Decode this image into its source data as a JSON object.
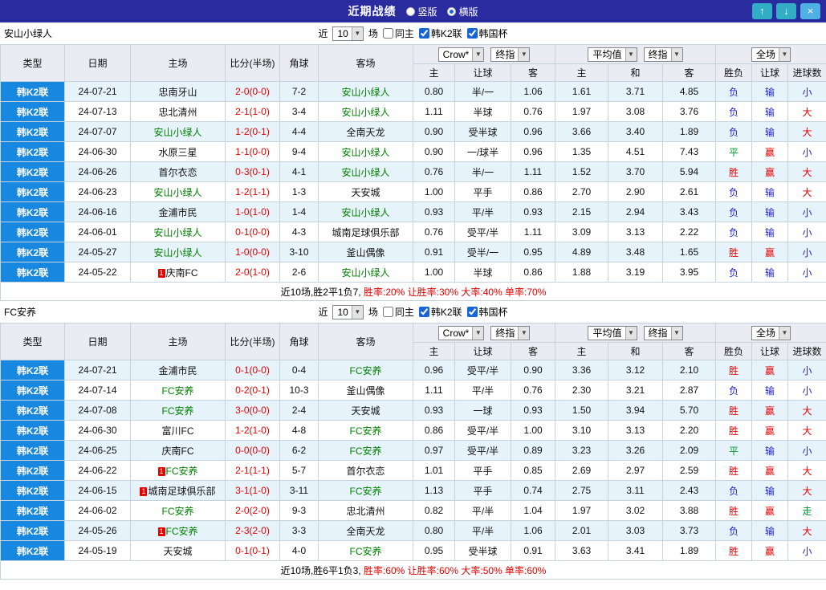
{
  "titlebar": {
    "title": "近期战绩",
    "radio_vertical": "竖版",
    "radio_horizontal": "横版",
    "up_icon": "↑",
    "down_icon": "↓",
    "close_icon": "×"
  },
  "filters": {
    "near": "近",
    "count": "10",
    "games": "场",
    "same_home": "同主",
    "k2": "韩K2联",
    "cup": "韩国杯"
  },
  "headers": {
    "type": "类型",
    "date": "日期",
    "home": "主场",
    "score": "比分(半场)",
    "corner": "角球",
    "away": "客场",
    "crow": "Crow*",
    "final": "终指",
    "avg": "平均值",
    "full": "全场",
    "h": "主",
    "hcap": "让球",
    "a": "客",
    "draw": "和",
    "wdl": "胜负",
    "hcap_res": "让球",
    "goals": "进球数"
  },
  "colors": {
    "win": "#e60000",
    "lose": "#2222cc",
    "draw": "#009933",
    "focal_team": "#008000",
    "score": "#e60000",
    "type_bg": "#1787e0",
    "titlebar_bg": "#2b2ba0"
  },
  "sections": [
    {
      "team": "安山小绿人",
      "rows": [
        {
          "league": "韩K2联",
          "date": "24-07-21",
          "home": "忠南牙山",
          "score": "2-0(0-0)",
          "corner": "7-2",
          "away": "安山小绿人",
          "crow_h": "0.80",
          "hcap": "半/一",
          "crow_a": "1.06",
          "avg_h": "1.61",
          "avg_d": "3.71",
          "avg_a": "4.85",
          "wdl": "负",
          "hcap_res": "输",
          "goals": "小"
        },
        {
          "league": "韩K2联",
          "date": "24-07-13",
          "home": "忠北清州",
          "score": "2-1(1-0)",
          "corner": "3-4",
          "away": "安山小绿人",
          "crow_h": "1.11",
          "hcap": "半球",
          "crow_a": "0.76",
          "avg_h": "1.97",
          "avg_d": "3.08",
          "avg_a": "3.76",
          "wdl": "负",
          "hcap_res": "输",
          "goals": "大"
        },
        {
          "league": "韩K2联",
          "date": "24-07-07",
          "home": "安山小绿人",
          "score": "1-2(0-1)",
          "corner": "4-4",
          "away": "全南天龙",
          "crow_h": "0.90",
          "hcap": "受半球",
          "crow_a": "0.96",
          "avg_h": "3.66",
          "avg_d": "3.40",
          "avg_a": "1.89",
          "wdl": "负",
          "hcap_res": "输",
          "goals": "大"
        },
        {
          "league": "韩K2联",
          "date": "24-06-30",
          "home": "水原三星",
          "score": "1-1(0-0)",
          "corner": "9-4",
          "away": "安山小绿人",
          "crow_h": "0.90",
          "hcap": "一/球半",
          "crow_a": "0.96",
          "avg_h": "1.35",
          "avg_d": "4.51",
          "avg_a": "7.43",
          "wdl": "平",
          "hcap_res": "赢",
          "goals": "小"
        },
        {
          "league": "韩K2联",
          "date": "24-06-26",
          "home": "首尔衣恋",
          "score": "0-3(0-1)",
          "corner": "4-1",
          "away": "安山小绿人",
          "crow_h": "0.76",
          "hcap": "半/一",
          "crow_a": "1.11",
          "avg_h": "1.52",
          "avg_d": "3.70",
          "avg_a": "5.94",
          "wdl": "胜",
          "hcap_res": "赢",
          "goals": "大"
        },
        {
          "league": "韩K2联",
          "date": "24-06-23",
          "home": "安山小绿人",
          "score": "1-2(1-1)",
          "corner": "1-3",
          "away": "天安城",
          "crow_h": "1.00",
          "hcap": "平手",
          "crow_a": "0.86",
          "avg_h": "2.70",
          "avg_d": "2.90",
          "avg_a": "2.61",
          "wdl": "负",
          "hcap_res": "输",
          "goals": "大"
        },
        {
          "league": "韩K2联",
          "date": "24-06-16",
          "home": "金浦市民",
          "score": "1-0(1-0)",
          "corner": "1-4",
          "away": "安山小绿人",
          "crow_h": "0.93",
          "hcap": "平/半",
          "crow_a": "0.93",
          "avg_h": "2.15",
          "avg_d": "2.94",
          "avg_a": "3.43",
          "wdl": "负",
          "hcap_res": "输",
          "goals": "小"
        },
        {
          "league": "韩K2联",
          "date": "24-06-01",
          "home": "安山小绿人",
          "score": "0-1(0-0)",
          "corner": "4-3",
          "away": "城南足球俱乐部",
          "crow_h": "0.76",
          "hcap": "受平/半",
          "crow_a": "1.11",
          "avg_h": "3.09",
          "avg_d": "3.13",
          "avg_a": "2.22",
          "wdl": "负",
          "hcap_res": "输",
          "goals": "小"
        },
        {
          "league": "韩K2联",
          "date": "24-05-27",
          "home": "安山小绿人",
          "score": "1-0(0-0)",
          "corner": "3-10",
          "away": "釜山偶像",
          "crow_h": "0.91",
          "hcap": "受半/一",
          "crow_a": "0.95",
          "avg_h": "4.89",
          "avg_d": "3.48",
          "avg_a": "1.65",
          "wdl": "胜",
          "hcap_res": "赢",
          "goals": "小"
        },
        {
          "league": "韩K2联",
          "date": "24-05-22",
          "home": "庆南FC",
          "home_rc": 1,
          "score": "2-0(1-0)",
          "corner": "2-6",
          "away": "安山小绿人",
          "crow_h": "1.00",
          "hcap": "半球",
          "crow_a": "0.86",
          "avg_h": "1.88",
          "avg_d": "3.19",
          "avg_a": "3.95",
          "wdl": "负",
          "hcap_res": "输",
          "goals": "小"
        }
      ],
      "footer_lead": "近10场,胜2平1负7,",
      "footer_stats": "胜率:20% 让胜率:30% 大率:40% 单率:70%"
    },
    {
      "team": "FC安养",
      "rows": [
        {
          "league": "韩K2联",
          "date": "24-07-21",
          "home": "金浦市民",
          "score": "0-1(0-0)",
          "corner": "0-4",
          "away": "FC安养",
          "crow_h": "0.96",
          "hcap": "受平/半",
          "crow_a": "0.90",
          "avg_h": "3.36",
          "avg_d": "3.12",
          "avg_a": "2.10",
          "wdl": "胜",
          "hcap_res": "赢",
          "goals": "小"
        },
        {
          "league": "韩K2联",
          "date": "24-07-14",
          "home": "FC安养",
          "score": "0-2(0-1)",
          "corner": "10-3",
          "away": "釜山偶像",
          "crow_h": "1.11",
          "hcap": "平/半",
          "crow_a": "0.76",
          "avg_h": "2.30",
          "avg_d": "3.21",
          "avg_a": "2.87",
          "wdl": "负",
          "hcap_res": "输",
          "goals": "小"
        },
        {
          "league": "韩K2联",
          "date": "24-07-08",
          "home": "FC安养",
          "score": "3-0(0-0)",
          "corner": "2-4",
          "away": "天安城",
          "crow_h": "0.93",
          "hcap": "一球",
          "crow_a": "0.93",
          "avg_h": "1.50",
          "avg_d": "3.94",
          "avg_a": "5.70",
          "wdl": "胜",
          "hcap_res": "赢",
          "goals": "大"
        },
        {
          "league": "韩K2联",
          "date": "24-06-30",
          "home": "富川FC",
          "score": "1-2(1-0)",
          "corner": "4-8",
          "away": "FC安养",
          "crow_h": "0.86",
          "hcap": "受平/半",
          "crow_a": "1.00",
          "avg_h": "3.10",
          "avg_d": "3.13",
          "avg_a": "2.20",
          "wdl": "胜",
          "hcap_res": "赢",
          "goals": "大"
        },
        {
          "league": "韩K2联",
          "date": "24-06-25",
          "home": "庆南FC",
          "score": "0-0(0-0)",
          "corner": "6-2",
          "away": "FC安养",
          "crow_h": "0.97",
          "hcap": "受平/半",
          "crow_a": "0.89",
          "avg_h": "3.23",
          "avg_d": "3.26",
          "avg_a": "2.09",
          "wdl": "平",
          "hcap_res": "输",
          "goals": "小"
        },
        {
          "league": "韩K2联",
          "date": "24-06-22",
          "home": "FC安养",
          "home_rc": 1,
          "score": "2-1(1-1)",
          "corner": "5-7",
          "away": "首尔衣恋",
          "crow_h": "1.01",
          "hcap": "平手",
          "crow_a": "0.85",
          "avg_h": "2.69",
          "avg_d": "2.97",
          "avg_a": "2.59",
          "wdl": "胜",
          "hcap_res": "赢",
          "goals": "大"
        },
        {
          "league": "韩K2联",
          "date": "24-06-15",
          "home": "城南足球俱乐部",
          "home_rc": 1,
          "score": "3-1(1-0)",
          "corner": "3-11",
          "away": "FC安养",
          "crow_h": "1.13",
          "hcap": "平手",
          "crow_a": "0.74",
          "avg_h": "2.75",
          "avg_d": "3.11",
          "avg_a": "2.43",
          "wdl": "负",
          "hcap_res": "输",
          "goals": "大"
        },
        {
          "league": "韩K2联",
          "date": "24-06-02",
          "home": "FC安养",
          "score": "2-0(2-0)",
          "corner": "9-3",
          "away": "忠北清州",
          "crow_h": "0.82",
          "hcap": "平/半",
          "crow_a": "1.04",
          "avg_h": "1.97",
          "avg_d": "3.02",
          "avg_a": "3.88",
          "wdl": "胜",
          "hcap_res": "赢",
          "goals": "走"
        },
        {
          "league": "韩K2联",
          "date": "24-05-26",
          "home": "FC安养",
          "home_rc": 1,
          "score": "2-3(2-0)",
          "corner": "3-3",
          "away": "全南天龙",
          "crow_h": "0.80",
          "hcap": "平/半",
          "crow_a": "1.06",
          "avg_h": "2.01",
          "avg_d": "3.03",
          "avg_a": "3.73",
          "wdl": "负",
          "hcap_res": "输",
          "goals": "大"
        },
        {
          "league": "韩K2联",
          "date": "24-05-19",
          "home": "天安城",
          "score": "0-1(0-1)",
          "corner": "4-0",
          "away": "FC安养",
          "crow_h": "0.95",
          "hcap": "受半球",
          "crow_a": "0.91",
          "avg_h": "3.63",
          "avg_d": "3.41",
          "avg_a": "1.89",
          "wdl": "胜",
          "hcap_res": "赢",
          "goals": "小"
        }
      ],
      "footer_lead": "近10场,胜6平1负3,",
      "footer_stats": "胜率:60% 让胜率:60% 大率:50% 单率:60%"
    }
  ]
}
